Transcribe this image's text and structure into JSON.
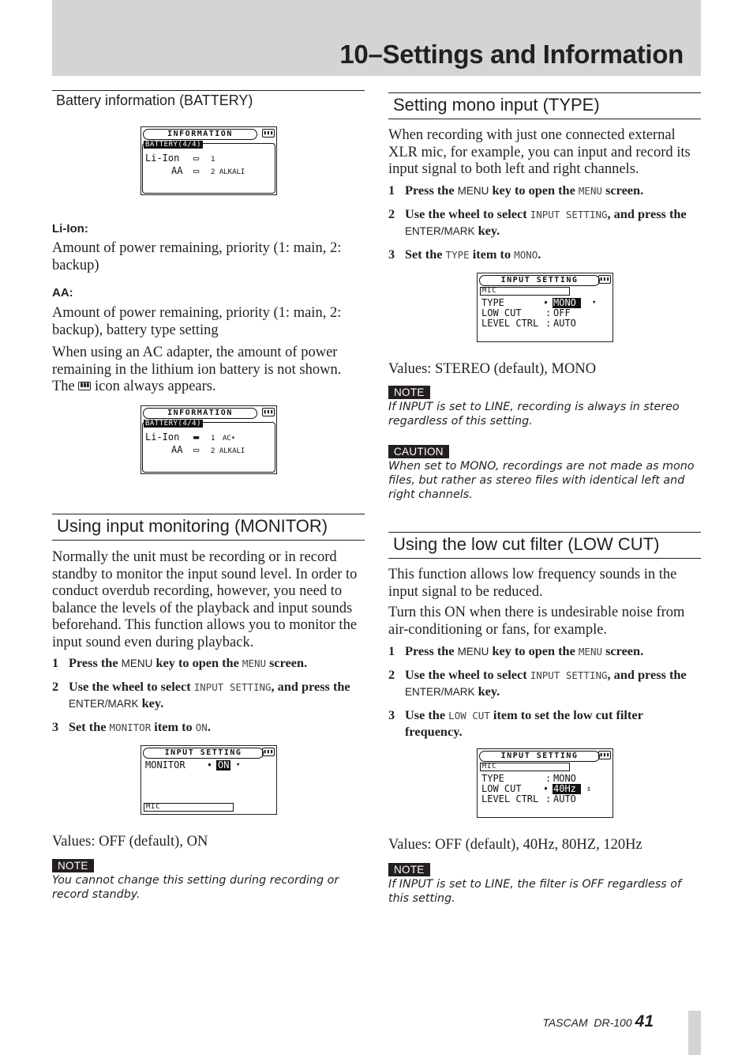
{
  "header": {
    "chapter_title": "10–Settings and Information"
  },
  "battery": {
    "heading": "Battery information (BATTERY)",
    "screen1": {
      "title": "INFORMATION",
      "tab": "BATTERY(4/4)",
      "line1": "Li-Ion",
      "line1_value": "1",
      "line2": "AA",
      "line2_value": "2 ALKALI"
    },
    "li_ion_label": "Li-Ion:",
    "li_ion_text": "Amount of power remaining, priority (1: main, 2: backup)",
    "aa_label": "AA:",
    "aa_text": "Amount of power remaining, priority (1: main, 2: backup), battery type setting",
    "ac_text_1": "When using an AC adapter, the amount of power remaining in the lithium ion battery is not shown. The",
    "ac_text_2": "icon always appears.",
    "screen2": {
      "title": "INFORMATION",
      "tab": "BATTERY(4/4)",
      "line1": "Li-Ion",
      "line1_value": "1",
      "line1_extra": "AC",
      "line2": "AA",
      "line2_value": "2 ALKALI"
    }
  },
  "monitor": {
    "heading": "Using input monitoring (MONITOR)",
    "intro": "Normally the unit must be recording or in record standby to monitor the input sound level. In order to conduct overdub recording, however, you need to balance the levels of the playback and input sounds beforehand. This function allows you to monitor the input sound even during playback.",
    "steps": [
      {
        "num": "1",
        "a": "Press the ",
        "key": "MENU",
        "b": " key to open the ",
        "lcd": "MENU",
        "c": " screen."
      },
      {
        "num": "2",
        "a": "Use the wheel to select ",
        "lcd": "INPUT SETTING",
        "b": ", and press the ",
        "key": "ENTER/MARK",
        "c": " key."
      },
      {
        "num": "3",
        "a": "Set the ",
        "lcd": "MONITOR",
        "b": " item to ",
        "lcd2": "ON",
        "c": "."
      }
    ],
    "screen": {
      "title": "INPUT SETTING",
      "item": "MONITOR",
      "value": "ON",
      "bottom": "MIC"
    },
    "values": "Values: OFF (default), ON",
    "note_tag": "NOTE",
    "note_text": "You cannot change this setting during recording or record standby."
  },
  "type": {
    "heading": "Setting mono input (TYPE)",
    "intro": "When recording with just one connected external XLR mic, for example, you can input and record its input signal to both left and right channels.",
    "steps": [
      {
        "num": "1",
        "a": "Press the ",
        "key": "MENU",
        "b": " key to open the ",
        "lcd": "MENU",
        "c": " screen."
      },
      {
        "num": "2",
        "a": "Use the wheel to select ",
        "lcd": "INPUT SETTING",
        "b": ", and press the ",
        "key": "ENTER/MARK",
        "c": " key."
      },
      {
        "num": "3",
        "a": "Set the ",
        "lcd": "TYPE",
        "b": " item to ",
        "lcd2": "MONO",
        "c": "."
      }
    ],
    "screen": {
      "title": "INPUT SETTING",
      "box": "MIC",
      "rows": [
        {
          "label": "TYPE",
          "sep": "➧",
          "value": "MONO"
        },
        {
          "label": "LOW CUT",
          "sep": ":",
          "value": "OFF"
        },
        {
          "label": "LEVEL CTRL",
          "sep": ":",
          "value": "AUTO"
        }
      ]
    },
    "values": "Values: STEREO (default), MONO",
    "note_tag": "NOTE",
    "note_text": "If INPUT is set to LINE, recording is always in stereo regardless of this setting.",
    "caution_tag": "CAUTION",
    "caution_text": "When set to MONO, recordings are not made as mono files, but rather as stereo files with identical left and right channels."
  },
  "lowcut": {
    "heading": "Using the low cut filter (LOW CUT)",
    "intro1": "This function allows low frequency sounds in the input signal to be reduced.",
    "intro2": "Turn this ON when there is undesirable noise from air-conditioning or fans, for example.",
    "steps": [
      {
        "num": "1",
        "a": "Press the ",
        "key": "MENU",
        "b": " key to open the ",
        "lcd": "MENU",
        "c": " screen."
      },
      {
        "num": "2",
        "a": "Use the wheel to select ",
        "lcd": "INPUT SETTING",
        "b": ", and press the ",
        "key": "ENTER/MARK",
        "c": " key."
      },
      {
        "num": "3",
        "a": "Use the ",
        "lcd": "LOW CUT",
        "b": " item to set the low cut filter frequency."
      }
    ],
    "screen": {
      "title": "INPUT SETTING",
      "box": "MIC",
      "rows": [
        {
          "label": "TYPE",
          "sep": ":",
          "value": "MONO"
        },
        {
          "label": "LOW CUT",
          "sep": "➧",
          "value": "40Hz"
        },
        {
          "label": "LEVEL CTRL",
          "sep": ":",
          "value": "AUTO"
        }
      ]
    },
    "values": "Values: OFF (default), 40Hz, 80HZ, 120Hz",
    "note_tag": "NOTE",
    "note_text": "If INPUT is set to LINE, the filter is OFF regardless of this setting."
  },
  "footer": {
    "brand": "TASCAM  DR-100",
    "page": "41"
  }
}
